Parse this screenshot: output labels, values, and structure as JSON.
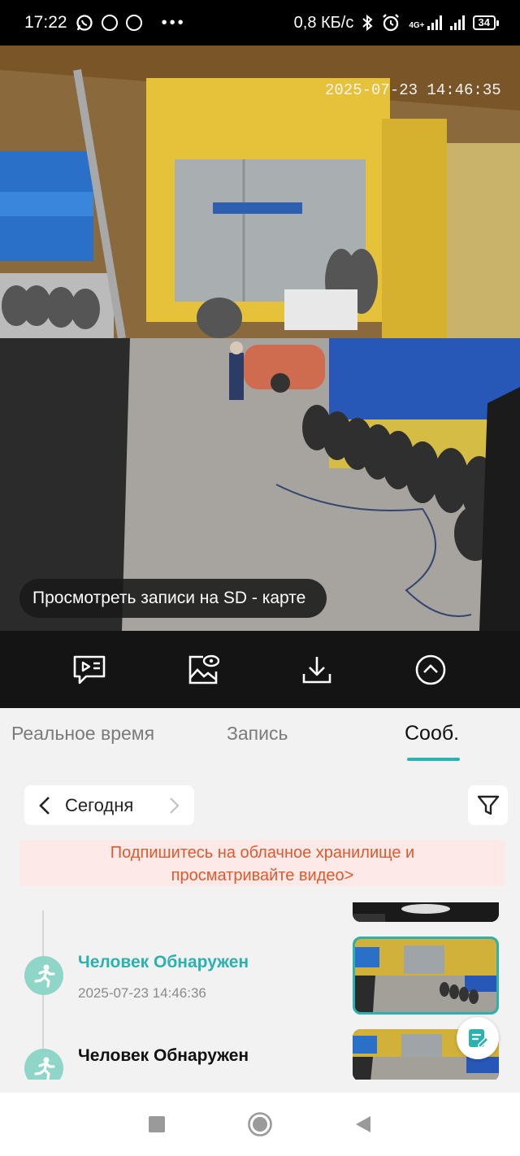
{
  "status_bar": {
    "time": "17:22",
    "network_speed": "0,8 КБ/с",
    "network_type": "4G+",
    "battery": "34",
    "icons": [
      "whatsapp-icon",
      "app-icon",
      "app-icon",
      "more-dots",
      "bluetooth-icon",
      "alarm-icon",
      "signal-icon",
      "signal-icon"
    ]
  },
  "video": {
    "timestamp": "2025-07-23  14:46:35",
    "sd_toast": "Просмотреть записи на SD - карте"
  },
  "toolbar": {
    "buttons": [
      "playback-icon",
      "gallery-icon",
      "download-icon",
      "chevron-up-icon"
    ]
  },
  "tabs": {
    "items": [
      {
        "label": "Реальное время",
        "active": false
      },
      {
        "label": "Запись",
        "active": false
      },
      {
        "label": "Сооб.",
        "active": true
      }
    ]
  },
  "date_selector": {
    "label": "Сегодня"
  },
  "promo": {
    "line1": "Подпишитесь на облачное хранилище и",
    "line2": "просматривайте видео>"
  },
  "events": [
    {
      "title": "Человек Обнаружен",
      "time": "2025-07-23 14:46:36",
      "selected": true,
      "title_color": "#2ab1b0"
    },
    {
      "title": "Человек Обнаружен",
      "time": "",
      "selected": false,
      "title_color": "#111111"
    }
  ],
  "colors": {
    "accent": "#2ab1b0",
    "promo_text": "#e0592c",
    "promo_bg": "#fde9e7"
  }
}
